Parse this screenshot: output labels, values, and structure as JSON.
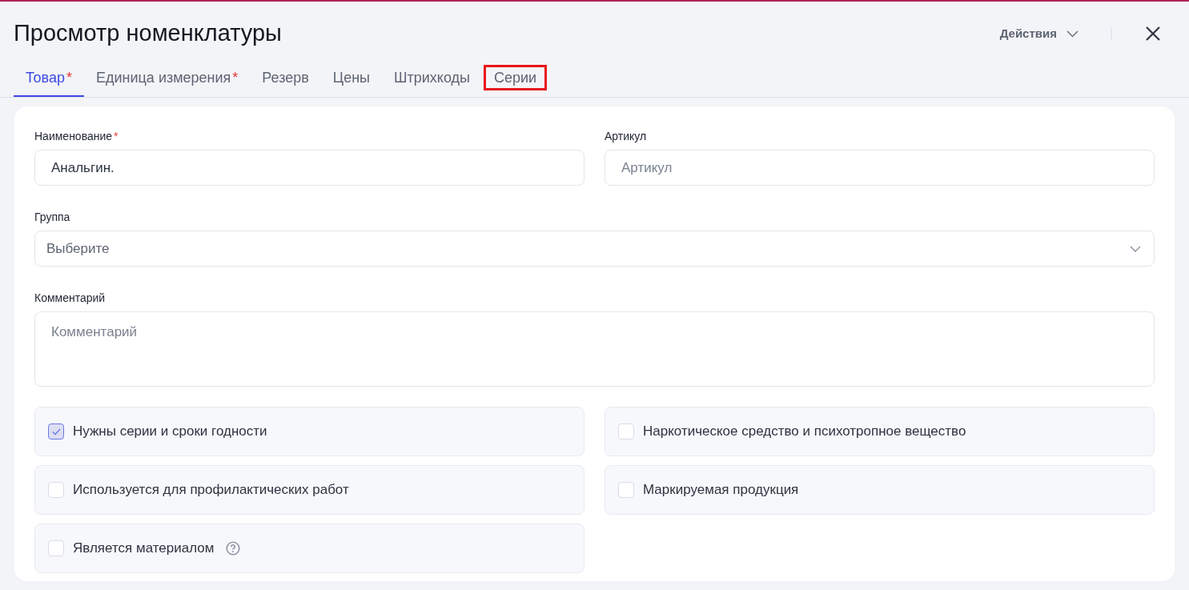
{
  "window": {
    "title": "Просмотр номенклатуры"
  },
  "actions": {
    "label": "Действия"
  },
  "tabs": [
    {
      "label": "Товар",
      "mark": "*",
      "selected": true,
      "highlighted": false
    },
    {
      "label": "Единица измерения",
      "mark": "*",
      "selected": false,
      "highlighted": false
    },
    {
      "label": "Резерв",
      "selected": false,
      "highlighted": false
    },
    {
      "label": "Цены",
      "selected": false,
      "highlighted": false
    },
    {
      "label": "Штрихкоды",
      "selected": false,
      "highlighted": false
    },
    {
      "label": "Серии",
      "selected": false,
      "highlighted": true
    }
  ],
  "fields": [
    {
      "kind": "text",
      "label": "Наименование",
      "mark": "*",
      "value": "Анальгин."
    },
    {
      "kind": "text",
      "label": "Артикул",
      "placeholder": "Артикул"
    },
    {
      "kind": "select",
      "label": "Группа",
      "placeholder": "Выберите"
    },
    {
      "kind": "textarea",
      "label": "Комментарий",
      "placeholder": "Комментарий"
    }
  ],
  "options": [
    {
      "label": "Нужны серии и сроки годности",
      "checked": true,
      "help": false
    },
    {
      "label": "Наркотическое средство и психотропное вещество",
      "checked": false,
      "help": false
    },
    {
      "label": "Используется для профилактических работ",
      "checked": false,
      "help": false
    },
    {
      "label": "Маркируемая продукция",
      "checked": false,
      "help": false
    },
    {
      "label": "Является материалом",
      "checked": false,
      "help": true
    }
  ]
}
